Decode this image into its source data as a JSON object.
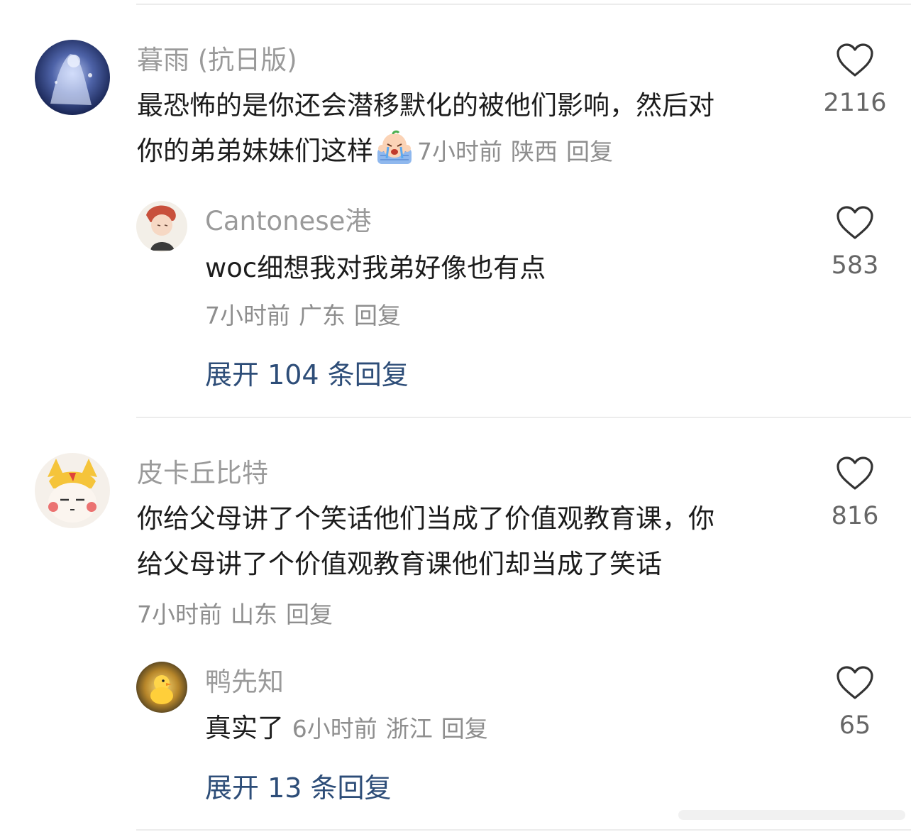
{
  "comments": [
    {
      "username": "暮雨 (抗日版)",
      "text_line1": "最恐怖的是你还会潜移默化的被他们影响，然后对",
      "text_line2": "你的弟弟妹妹们这样",
      "emoji": "crying-face-emoji",
      "time": "7小时前",
      "location": "陕西",
      "reply_label": "回复",
      "likes": "2116",
      "replies": [
        {
          "username": "Cantonese港",
          "text": "woc细想我对我弟好像也有点",
          "time": "7小时前",
          "location": "广东",
          "reply_label": "回复",
          "likes": "583"
        }
      ],
      "expand_label": "展开 104 条回复"
    },
    {
      "username": "皮卡丘比特",
      "text_line1": "你给父母讲了个笑话他们当成了价值观教育课，你",
      "text_line2": "给父母讲了个价值观教育课他们却当成了笑话",
      "time": "7小时前",
      "location": "山东",
      "reply_label": "回复",
      "likes": "816",
      "replies": [
        {
          "username": "鸭先知",
          "text": "真实了",
          "time": "6小时前",
          "location": "浙江",
          "reply_label": "回复",
          "likes": "65"
        }
      ],
      "expand_label": "展开 13 条回复"
    }
  ],
  "colors": {
    "username": "#9a9a9a",
    "content": "#1c1c1c",
    "meta": "#8e8e8e",
    "expand_link": "#2d4d78",
    "divider": "#ececec",
    "heart_outline": "#333333"
  },
  "icons": {
    "like": "heart-outline-icon"
  }
}
